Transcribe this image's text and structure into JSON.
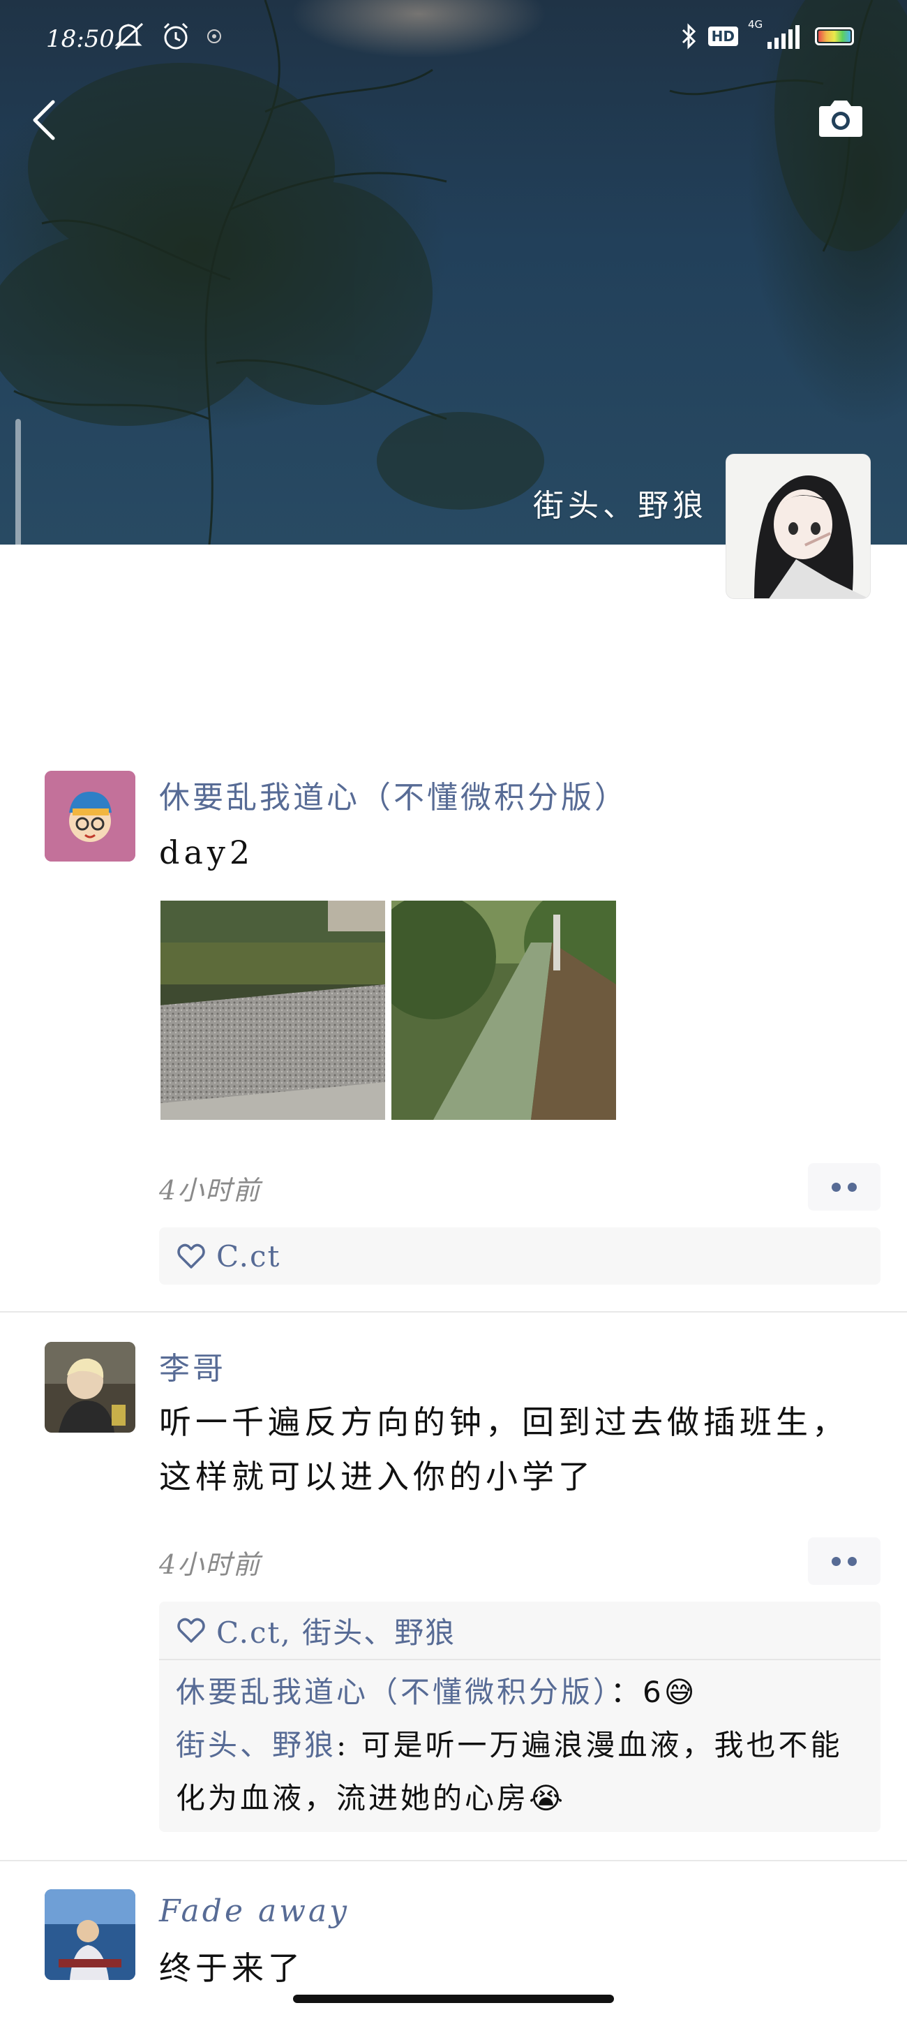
{
  "status_bar": {
    "time": "18:50",
    "network": "4G",
    "hd_label": "HD",
    "icons": [
      "mute-icon",
      "alarm-icon",
      "location-icon",
      "bluetooth-icon",
      "hd-icon",
      "signal-icon",
      "battery-icon"
    ]
  },
  "header": {
    "back_icon": "chevron-left-icon",
    "camera_icon": "camera-icon",
    "owner_name": "街头、野狼"
  },
  "posts": [
    {
      "username": "休要乱我道心（不懂微积分版）",
      "content": "day2",
      "images": [
        "gravel-photo",
        "path-photo"
      ],
      "time": "4小时前",
      "likes": "C.ct",
      "comments": []
    },
    {
      "username": "李哥",
      "content": "听一千遍反方向的钟，回到过去做插班生，这样就可以进入你的小学了",
      "time": "4小时前",
      "likes": "C.ct, 街头、野狼",
      "comments": [
        {
          "name": "休要乱我道心（不懂微积分版）",
          "sep": "：",
          "text": "6😅"
        },
        {
          "name": "街头、野狼",
          "sep": ": ",
          "text": "可是听一万遍浪漫血液，我也不能化为血液，流进她的心房😭"
        }
      ]
    },
    {
      "username": "Fade away",
      "content": "终于来了"
    }
  ],
  "colors": {
    "link": "#576b95",
    "text": "#111111",
    "muted": "#8a8a8a",
    "box_bg": "#f7f7f7"
  }
}
